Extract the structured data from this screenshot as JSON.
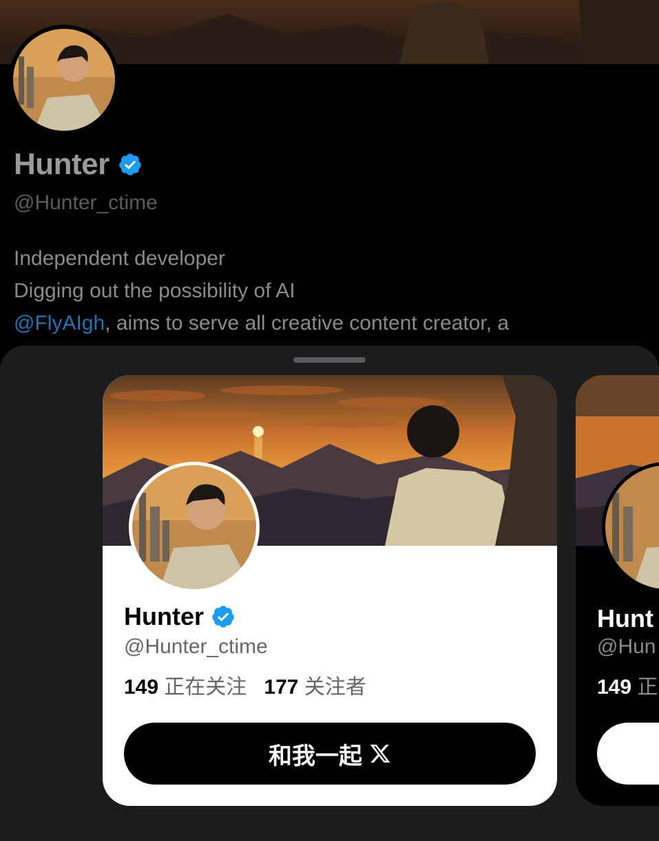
{
  "profile": {
    "name": "Hunter",
    "handle": "@Hunter_ctime",
    "bio": {
      "line1": "Independent developer",
      "line2": "Digging out the possibility of AI",
      "line3_mention": "@FlyAIgh",
      "line3_rest": ", aims to serve all creative content creator, a"
    }
  },
  "card": {
    "name": "Hunter",
    "handle": "@Hunter_ctime",
    "following_count": "149",
    "following_label": "正在关注",
    "followers_count": "177",
    "followers_label": "关注者",
    "button_label": "和我一起"
  },
  "card_peek": {
    "name": "Hunt",
    "handle": "@Hun",
    "following_count": "149",
    "following_label": "正"
  },
  "colors": {
    "verified": "#1d9bf0",
    "link": "#1d74b8",
    "sky": "#e0822f"
  },
  "icons": [
    "verified-badge-icon",
    "x-logo-icon"
  ]
}
